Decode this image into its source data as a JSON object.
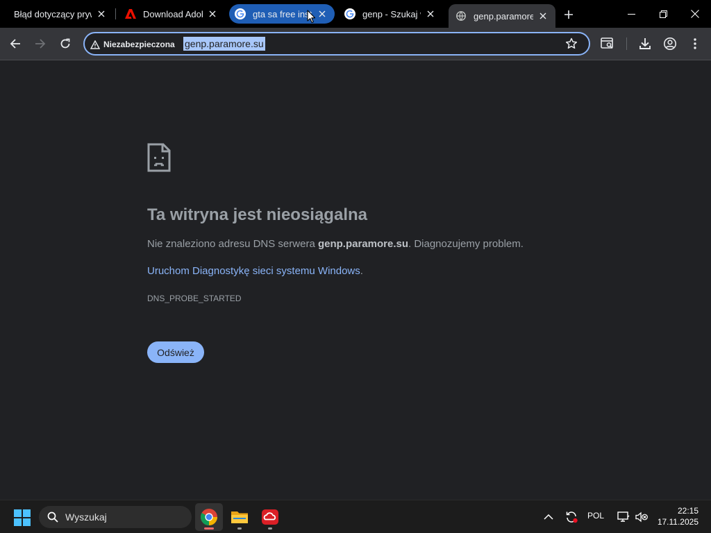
{
  "browser": {
    "tabs": [
      {
        "title": "Błąd dotyczący prywatności",
        "favicon": "none",
        "state": "normal"
      },
      {
        "title": "Download Adobe",
        "favicon": "adobe-icon",
        "state": "normal"
      },
      {
        "title": "gta sa free install",
        "favicon": "google-icon",
        "state": "highlighted"
      },
      {
        "title": "genp - Szukaj w Google",
        "favicon": "google-icon",
        "state": "normal"
      },
      {
        "title": "genp.paramore.su",
        "favicon": "globe-icon",
        "state": "active"
      }
    ],
    "accent_color": "#8ab4f8",
    "omnibox": {
      "security_chip": "Niezabezpieczona",
      "url": "genp.paramore.su"
    }
  },
  "error_page": {
    "title": "Ta witryna jest nieosiągalna",
    "desc_before": "Nie znaleziono adresu DNS serwera ",
    "desc_host": "genp.paramore.su",
    "desc_after": ". Diagnozujemy problem.",
    "link_text": "Uruchom Diagnostykę sieci systemu Windows",
    "link_suffix": ".",
    "error_code": "DNS_PROBE_STARTED",
    "reload_label": "Odśwież"
  },
  "taskbar": {
    "search_placeholder": "Wyszukaj",
    "apps": [
      "chrome-icon",
      "file-explorer-icon",
      "adobe-creative-cloud-icon"
    ],
    "language": "POL",
    "time": "22:15",
    "date": "17.11.2025"
  }
}
